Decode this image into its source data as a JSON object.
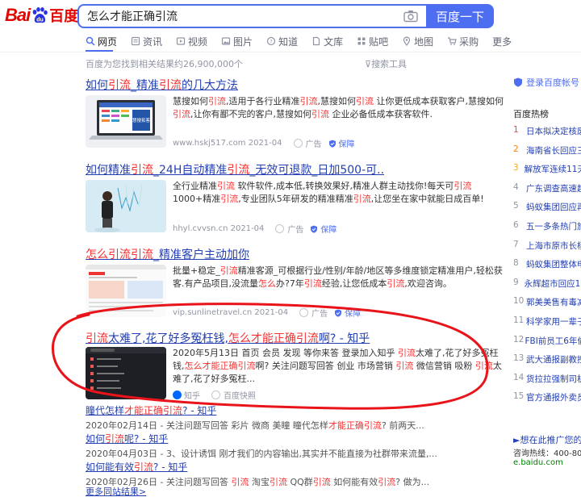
{
  "logo": {
    "bai": "Bai",
    "du": "百度"
  },
  "search": {
    "query": "怎么才能正确引流",
    "button": "百度一下"
  },
  "tabs": [
    {
      "label": "网页",
      "active": true
    },
    {
      "label": "资讯"
    },
    {
      "label": "视频"
    },
    {
      "label": "图片"
    },
    {
      "label": "知道"
    },
    {
      "label": "文库"
    },
    {
      "label": "贴吧"
    },
    {
      "label": "地图"
    },
    {
      "label": "采购"
    },
    {
      "label": "更多"
    }
  ],
  "result_count": "百度为您找到相关结果约26,900,000个",
  "tools": "搜索工具",
  "results": [
    {
      "title_a": "如何",
      "title_hl1": "引流",
      "title_b": "_精准",
      "title_hl2": "引流",
      "title_c": "的几大方法",
      "thumb_label": "慧搜拓客",
      "text": "慧搜如何引流,适用于各行业精准引流,慧搜如何引流 让你更低成本获取客户,慧搜如何引流,让你有鄙不完的客户,慧搜如何引流 企业必备低成本获客软件.",
      "url": "www.hskj517.com 2021-04",
      "ad": "广告",
      "guard": "保障"
    },
    {
      "title": "如何精准引流_24H自动精准引流_无效可退款_日加500-可..",
      "text": "全行业精准引流 软件软件,成本低,转换效果好,精准人群主动找你!每天可引流1000+精准引流,专业团队5年研发的精准精准引流,让您坐在家中就能日成百单!",
      "url": "hhyl.cvvsn.cn 2021-04",
      "ad": "广告",
      "guard": "保障"
    },
    {
      "title": "怎么引流引流_精准客户主动加你",
      "text": "批量+稳定_引流精准客源_可根据行业/性别/年龄/地区等多维度锁定精准用户,轻松获客.有产品项目,没流量怎么办?7年引流经验,让您低成本引流,欢迎咨询。",
      "url": "vip.sunlinetravel.cn 2021-04",
      "ad": "广告",
      "guard": "保障"
    },
    {
      "title": "引流太难了,花了好多冤枉钱,怎么才能正确引流啊? - 知乎",
      "text": "2020年5月13日 首页 会员 发现 等你来答  登录加入知乎 引流太难了,花了好多冤枉钱,怎么才能正确引流啊? 关注问题写回答 创业 市场营销 引流 微信营销 吸粉 引流太难了,花了好多冤枉...",
      "source": "知乎",
      "snapshot": "百度快照"
    }
  ],
  "subresults": [
    {
      "title": "瞳代怎样才能正确引流? - 知乎",
      "desc": "2020年02月14日 - 关注问题写回答 彩片 微商 美瞳 瞳代怎样才能正确引流? 前两天..."
    },
    {
      "title": "如何引流呢? - 知乎",
      "desc": "2020年04月03日 - 3、设计诱饵 刚才我们的内容输出,其实并不能直接为社群带来流量,..."
    },
    {
      "title": "如何能有效引流? - 知乎",
      "desc": "2020年02月26日 - 关注问题写回答 引流 淘宝引流 QQ群引流 如何能有效引流? 做为..."
    }
  ],
  "more_link": "更多同站结果>",
  "sidebar": {
    "login": "登录百度帐号",
    "hot_title": "百度热榜",
    "hot": [
      {
        "n": "1",
        "t": "日本拟决定核废"
      },
      {
        "n": "2",
        "t": "海南省长回应三"
      },
      {
        "n": "3",
        "t": "解放军连续11天"
      },
      {
        "n": "4",
        "t": "广东调查高速超"
      },
      {
        "n": "5",
        "t": "蚂蚁集团回应再"
      },
      {
        "n": "6",
        "t": "五一多条热门旅"
      },
      {
        "n": "7",
        "t": "上海市原市长杨"
      },
      {
        "n": "8",
        "t": "蚂蚁集团整体申"
      },
      {
        "n": "9",
        "t": "永辉超市回应10"
      },
      {
        "n": "10",
        "t": "郭美美售有毒减"
      },
      {
        "n": "11",
        "t": "科学家用一辈子"
      },
      {
        "n": "12",
        "t": "FBI前员工6年偷"
      },
      {
        "n": "13",
        "t": "武大通报副教授"
      },
      {
        "n": "14",
        "t": "货拉拉强制司机"
      },
      {
        "n": "15",
        "t": "官方通报外卖员"
      }
    ],
    "promo": "►想在此推广您的",
    "promo_tel": "咨询热线：400-800-",
    "promo_url": "e.baidu.com"
  },
  "colors": {
    "brand": "#4e6ef2",
    "highlight": "#f73131",
    "link": "#2440b3",
    "annotation": "#e8141a"
  }
}
